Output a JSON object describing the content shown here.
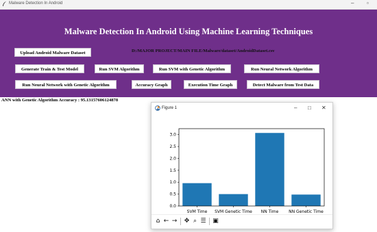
{
  "window": {
    "title": "Malware Detection In Android",
    "minimize_label": "–",
    "maximize_label": "▫"
  },
  "app": {
    "heading": "Malware Detection In Android Using Machine Learning Techniques",
    "dataset_path": "D:/MAJOR PROJECT/MAIN FILE/Malware/dataset/AndroidDataset.csv",
    "accuracy_text": "ANN with Genetic Algorithm Accuracy : 95.13157606124878",
    "buttons": {
      "upload": "Upload Android Malware Dataset",
      "generate": "Generate Train & Test Model",
      "run_svm": "Run SVM Algorithm",
      "run_svm_genetic": "Run SVM with Genetic Algorithm",
      "run_nn": "Run Neural Network Algorithm",
      "run_nn_genetic": "Run Neural Network with Genetic Algorithm",
      "accuracy_graph": "Accuracy Graph",
      "execution_graph": "Execution Time Graph",
      "detect": "Detect Malware from Test Data"
    },
    "colors": {
      "header": "#6f2f8a",
      "bar": "#1f77b4"
    }
  },
  "figure": {
    "title": "Figure 1",
    "minimize_label": "–",
    "maximize_label": "□",
    "close_label": "✕",
    "toolbar": {
      "home": "home-icon",
      "back": "back-icon",
      "forward": "forward-icon",
      "pan": "pan-icon",
      "zoom": "zoom-icon",
      "configure": "configure-icon",
      "save": "save-icon"
    }
  },
  "chart_data": {
    "type": "bar",
    "categories": [
      "SVM Time",
      "SVM Genetic Time",
      "NN Time",
      "NN Genetic Time"
    ],
    "values": [
      0.96,
      0.5,
      3.07,
      0.48
    ],
    "ylim": [
      0,
      3.25
    ],
    "yticks": [
      "0.0",
      "0.5",
      "1.0",
      "1.5",
      "2.0",
      "2.5",
      "3.0"
    ],
    "ytick_values": [
      0,
      0.5,
      1.0,
      1.5,
      2.0,
      2.5,
      3.0
    ],
    "title": "",
    "xlabel": "",
    "ylabel": "",
    "grid": false
  }
}
